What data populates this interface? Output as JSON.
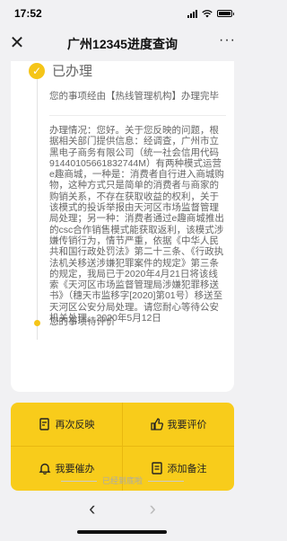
{
  "status_bar": {
    "time": "17:52"
  },
  "navbar": {
    "close": "✕",
    "title": "广州12345进度查询",
    "more": "···"
  },
  "timeline": {
    "done_label": "已办理",
    "done_summary": "您的事项经由【热线管理机构】办理完毕",
    "detail": "办理情况：您好。关于您反映的问题，根据相关部门提供信息：经调查，广州市立黑电子商务有限公司（统一社会信用代码91440105661832744M）有两种模式运营e趣商城，一种是：消费者自行进入商城购物，这种方式只是简单的消费者与商家的购销关系，不存在获取收益的权利，关于该模式的投诉举报由天河区市场监督管理局处理；另一种：消费者通过e趣商城推出的csc合作销售模式能获取返利，该模式涉嫌传销行为，情节严重，依据《中华人民共和国行政处罚法》第二十三条、《行政执法机关移送涉嫌犯罪案件的规定》第三条的规定，我局已于2020年4月21日将该线索《天河区市场监督管理局涉嫌犯罪移送书》（穗天市监移字[2020]第01号）移送至天河区公安分局处理。请您耐心等待公安机关处理。2020年5月12日",
    "pending_label": "您的事项待评价"
  },
  "actions": [
    {
      "label": "再次反映",
      "icon": "edit-document-icon"
    },
    {
      "label": "我要评价",
      "icon": "thumbs-up-icon"
    },
    {
      "label": "我要催办",
      "icon": "bell-icon"
    },
    {
      "label": "添加备注",
      "icon": "note-icon"
    }
  ],
  "footer": {
    "end_text": "已经到底啦",
    "back": "‹",
    "forward": "›"
  }
}
